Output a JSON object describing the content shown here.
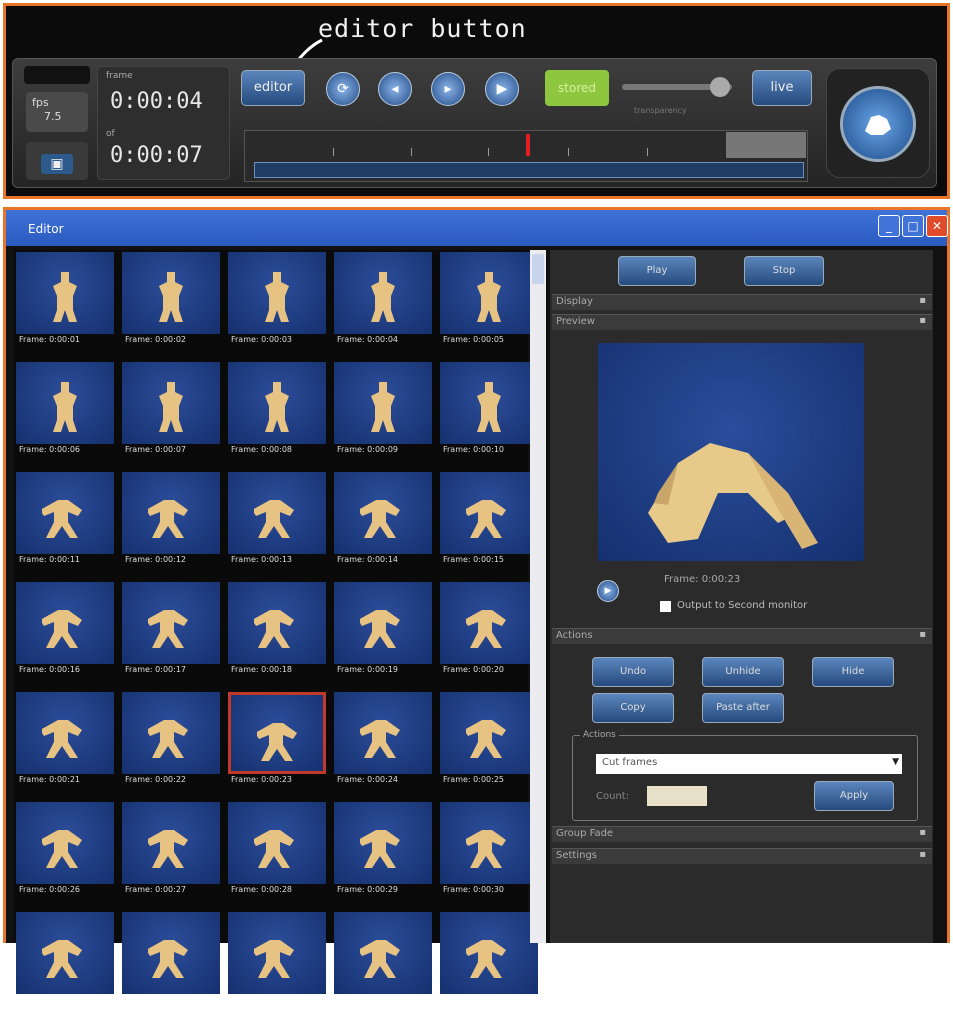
{
  "annotation": {
    "label": "editor button"
  },
  "capture_bar": {
    "fps_label": "fps",
    "fps_value": "7.5",
    "replay_label": "frame",
    "replay_time": "0:00:04",
    "of_label": "of",
    "total_time": "0:00:07",
    "editor_label": "editor",
    "stored_label": "stored",
    "live_label": "live",
    "slider_label": "transparency"
  },
  "editor": {
    "window_title": "Editor",
    "thumbnails": [
      "Frame: 0:00:01",
      "Frame: 0:00:02",
      "Frame: 0:00:03",
      "Frame: 0:00:04",
      "Frame: 0:00:05",
      "Frame: 0:00:06",
      "Frame: 0:00:07",
      "Frame: 0:00:08",
      "Frame: 0:00:09",
      "Frame: 0:00:10",
      "Frame: 0:00:11",
      "Frame: 0:00:12",
      "Frame: 0:00:13",
      "Frame: 0:00:14",
      "Frame: 0:00:15",
      "Frame: 0:00:16",
      "Frame: 0:00:17",
      "Frame: 0:00:18",
      "Frame: 0:00:19",
      "Frame: 0:00:20",
      "Frame: 0:00:21",
      "Frame: 0:00:22",
      "Frame: 0:00:23",
      "Frame: 0:00:24",
      "Frame: 0:00:25",
      "Frame: 0:00:26",
      "Frame: 0:00:27",
      "Frame: 0:00:28",
      "Frame: 0:00:29",
      "Frame: 0:00:30"
    ],
    "selected_index": 22,
    "panel": {
      "top_buttons": [
        "Play",
        "Stop"
      ],
      "sections": {
        "display": "Display",
        "preview": "Preview",
        "actions": "Actions",
        "group_fade": "Group Fade",
        "settings": "Settings"
      },
      "preview_frame": "Frame: 0:00:23",
      "second_monitor": "Output to Second monitor",
      "action_buttons": [
        "Undo",
        "Unhide",
        "Hide",
        "Copy",
        "Paste after"
      ],
      "actions_group_title": "Actions",
      "action_select": "Cut frames",
      "count_label": "Count:",
      "count_value": "",
      "apply_label": "Apply"
    }
  }
}
